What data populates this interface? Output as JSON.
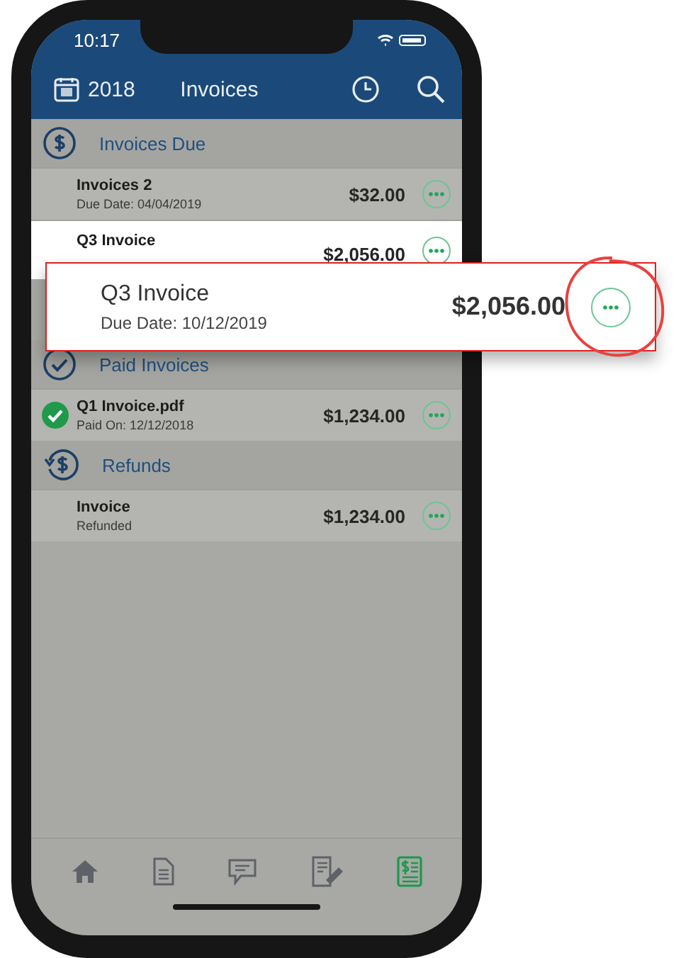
{
  "status_bar": {
    "time": "10:17"
  },
  "header": {
    "year": "2018",
    "title": "Invoices"
  },
  "sections": [
    {
      "kind": "due",
      "title": "Invoices Due",
      "rows": [
        {
          "name": "Invoices 2",
          "detail_label": "Due Date:",
          "detail_value": "04/04/2019",
          "amount": "$32.00",
          "selected": false,
          "paid": false
        },
        {
          "name": "Q3 Invoice",
          "amount": "$2,056.00",
          "selected": true,
          "paid": false
        }
      ]
    },
    {
      "kind": "paid",
      "title": "Paid Invoices",
      "rows": [
        {
          "name": "Q1 Invoice.pdf",
          "detail_label": "Paid On:",
          "detail_value": "12/12/2018",
          "amount": "$1,234.00",
          "selected": false,
          "paid": true
        }
      ]
    },
    {
      "kind": "refund",
      "title": "Refunds",
      "rows": [
        {
          "name": "Invoice",
          "detail_label": "Refunded",
          "amount": "$1,234.00",
          "selected": false,
          "paid": false
        }
      ]
    }
  ],
  "callout": {
    "name": "Q3 Invoice",
    "detail_label": "Due Date:",
    "detail_value": "10/12/2019",
    "amount": "$2,056.00"
  },
  "tab_bar": [
    {
      "kind": "home",
      "selected": false
    },
    {
      "kind": "document",
      "selected": false
    },
    {
      "kind": "chat",
      "selected": false
    },
    {
      "kind": "check",
      "selected": false
    },
    {
      "kind": "invoice",
      "selected": true
    }
  ]
}
